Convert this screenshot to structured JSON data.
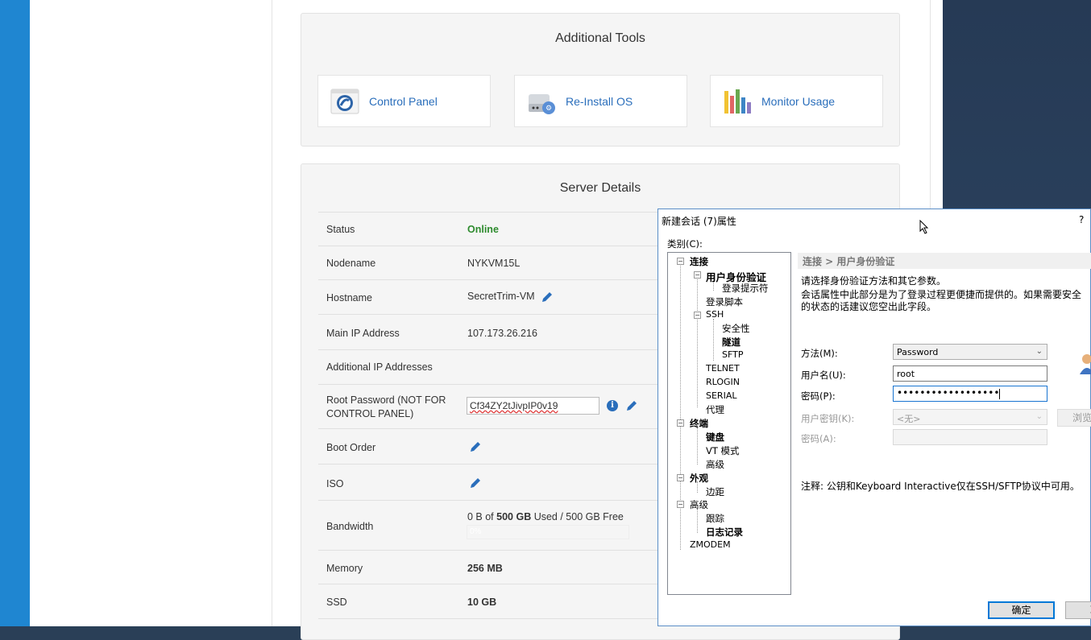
{
  "tools": {
    "title": "Additional Tools",
    "items": [
      {
        "label": "Control Panel",
        "icon": "control-panel-icon"
      },
      {
        "label": "Re-Install OS",
        "icon": "reinstall-os-icon"
      },
      {
        "label": "Monitor Usage",
        "icon": "monitor-usage-icon"
      }
    ]
  },
  "server": {
    "title": "Server Details",
    "status_label": "Status",
    "status_value": "Online",
    "nodename_label": "Nodename",
    "nodename_value": "NYKVM15L",
    "hostname_label": "Hostname",
    "hostname_value": "SecretTrim-VM",
    "main_ip_label": "Main IP Address",
    "main_ip_value": "107.173.26.216",
    "additional_ip_label": "Additional IP Addresses",
    "root_pw_label": "Root Password (NOT FOR CONTROL PANEL)",
    "root_pw_value": "Cf34ZY2tJivpIP0v19",
    "boot_order_label": "Boot Order",
    "iso_label": "ISO",
    "bandwidth_label": "Bandwidth",
    "bandwidth_pre": "0 B of ",
    "bandwidth_total": "500 GB",
    "bandwidth_post": " Used / 500 GB Free",
    "bandwidth_bar_text": "0%",
    "bandwidth_fraction": 0,
    "memory_label": "Memory",
    "memory_value": "256 MB",
    "ssd_label": "SSD",
    "ssd_value": "10 GB"
  },
  "dialog": {
    "title": "新建会话 (7)属性",
    "help": "?",
    "category_label": "类别(C):",
    "tree": [
      "连接",
      "用户身份验证",
      "登录提示符",
      "登录脚本",
      "SSH",
      "安全性",
      "隧道",
      "SFTP",
      "TELNET",
      "RLOGIN",
      "SERIAL",
      "代理",
      "终端",
      "键盘",
      "VT 模式",
      "高级",
      "外观",
      "边距",
      "高级",
      "跟踪",
      "日志记录",
      "ZMODEM"
    ],
    "breadcrumb": "连接 > 用户身份验证",
    "intro": "请选择身份验证方法和其它参数。",
    "desc_line1": "会话属性中此部分是为了登录过程更便捷而提供的。如果需要安全",
    "desc_line2": "的状态的话建议您空出此字段。",
    "method_label": "方法(M):",
    "method_value": "Password",
    "username_label": "用户名(U):",
    "username_value": "root",
    "password_label": "密码(P):",
    "password_value": "••••••••••••••••••",
    "user_key_label": "用户密钥(K):",
    "user_key_value": "<无>",
    "passphrase_label": "密码(A):",
    "browse_label": "浏览",
    "note": "注释: 公钥和Keyboard Interactive仅在SSH/SFTP协议中可用。",
    "ok_label": "确定",
    "cancel_label": "取"
  }
}
